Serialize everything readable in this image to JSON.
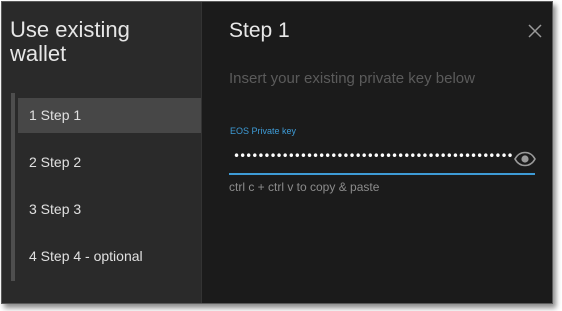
{
  "sidebar": {
    "title": "Use existing wallet",
    "steps": [
      {
        "label": "1  Step 1",
        "active": true
      },
      {
        "label": "2  Step 2",
        "active": false
      },
      {
        "label": "3  Step 3",
        "active": false
      },
      {
        "label": "4  Step 4 - optional",
        "active": false
      }
    ]
  },
  "main": {
    "title": "Step 1",
    "instruction": "Insert your existing private key below",
    "field": {
      "label": "EOS Private key",
      "value": "••••••••••••••••••••••••••••••••••••••••••••••••••••",
      "hint": "ctrl c + ctrl v to copy & paste"
    }
  },
  "icons": {
    "close": "close-icon",
    "toggle_visibility": "eye-icon"
  },
  "colors": {
    "accent": "#3e9bd6",
    "sidebar_bg": "#2a2a2a",
    "main_bg": "#1b1b1b",
    "active_step_bg": "#474747"
  }
}
